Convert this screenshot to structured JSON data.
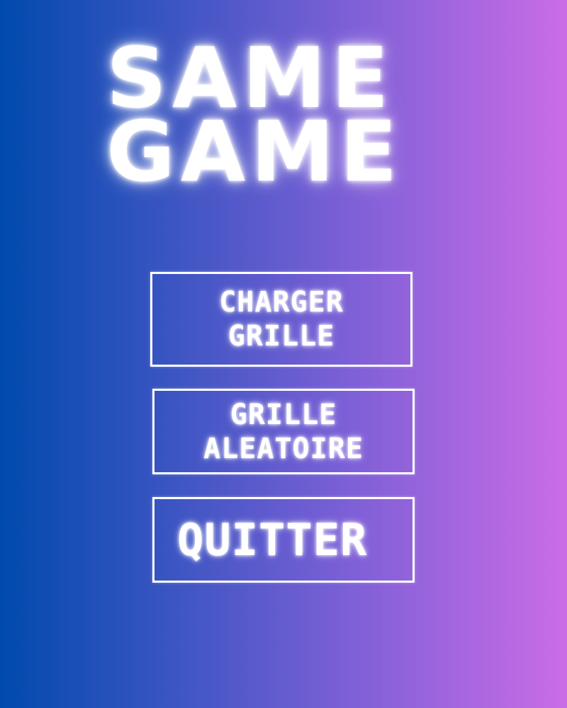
{
  "title": {
    "line1": "SAME",
    "line2": "GAME"
  },
  "menu": {
    "load_grid": "CHARGER\nGRILLE",
    "random_grid": "GRILLE\nALEATOIRE",
    "quit": "QUITTER"
  },
  "colors": {
    "gradient_left": "#004aad",
    "gradient_right": "#cb6ce6",
    "text": "#ffffff"
  }
}
